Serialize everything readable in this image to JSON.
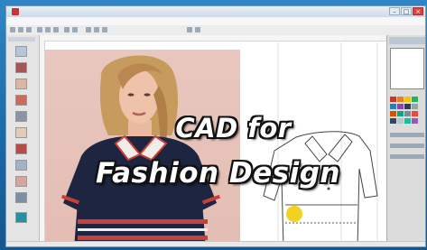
{
  "headline": {
    "line1": "CAD for",
    "line2": "Fashion Design"
  },
  "colors": {
    "desktop": "#1b6fae",
    "headline_text": "#ffffff",
    "headline_outline": "#111111",
    "photo_background": "#e6c2b9",
    "dress_navy": "#1d2540",
    "stripe_red": "#c8403a",
    "highlight_yellow": "#f3d21e"
  },
  "icons": [
    "app-icon",
    "minimize-icon",
    "maximize-icon",
    "close-icon"
  ]
}
